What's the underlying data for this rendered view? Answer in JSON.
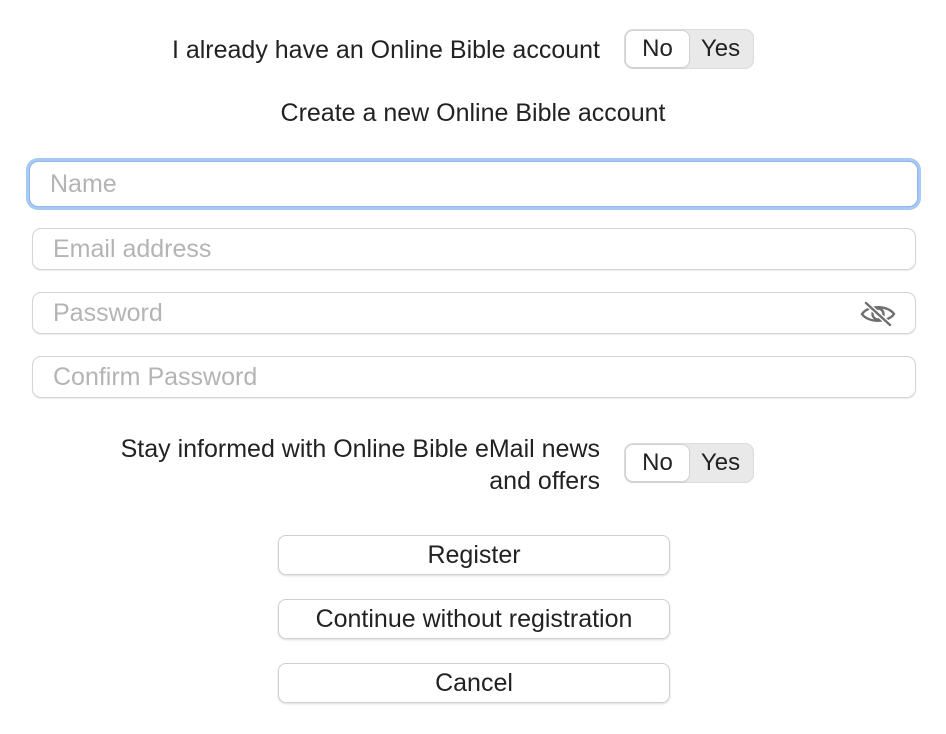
{
  "account_toggle": {
    "label": "I already have an Online Bible account",
    "options": [
      "No",
      "Yes"
    ],
    "selected": "No"
  },
  "subtitle": "Create a new Online Bible account",
  "fields": {
    "name": {
      "placeholder": "Name",
      "value": ""
    },
    "email": {
      "placeholder": "Email address",
      "value": ""
    },
    "password": {
      "placeholder": "Password",
      "value": ""
    },
    "confirm": {
      "placeholder": "Confirm Password",
      "value": ""
    }
  },
  "password_visibility_icon": "eye-slash-icon",
  "news_toggle": {
    "label_line1": "Stay informed with Online Bible eMail news",
    "label_line2": "and offers",
    "options": [
      "No",
      "Yes"
    ],
    "selected": "No"
  },
  "buttons": {
    "register": "Register",
    "continue": "Continue without registration",
    "cancel": "Cancel"
  },
  "colors": {
    "focus_ring": "#a9c9f5",
    "segment_bg": "#e9e9e9",
    "placeholder": "#b4b4b4"
  }
}
